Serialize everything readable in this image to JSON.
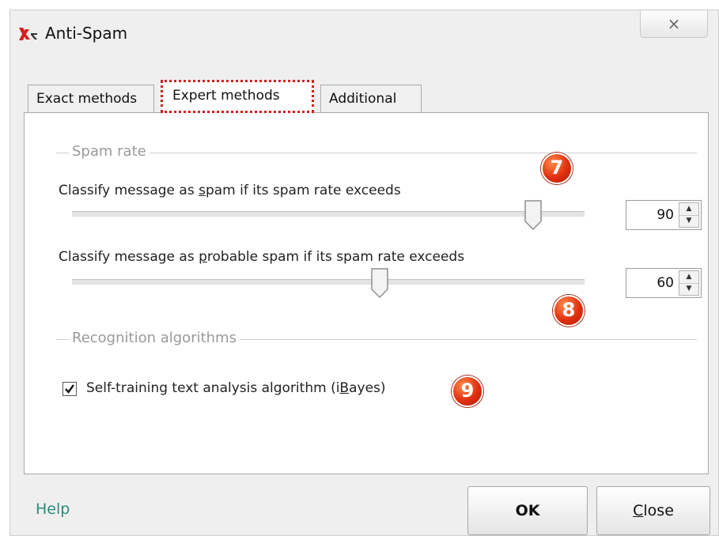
{
  "window": {
    "title": "Anti-Spam",
    "close_glyph": "×"
  },
  "tabs": [
    {
      "label": "Exact methods",
      "active": false
    },
    {
      "label": "Expert methods",
      "active": true,
      "highlight_color": "#d41e1e"
    },
    {
      "label": "Additional",
      "active": false
    }
  ],
  "spam_rate": {
    "group_title": "Spam rate",
    "spam": {
      "label_pre": "Classify message as ",
      "label_accel": "s",
      "label_post": "pam if its spam rate exceeds",
      "value": "90",
      "slider_percent": 90
    },
    "probable": {
      "label_pre": "Classify message as ",
      "label_accel": "p",
      "label_post": "robable spam if its spam rate exceeds",
      "value": "60",
      "slider_percent": 60
    }
  },
  "recognition": {
    "group_title": "Recognition algorithms",
    "ibayes": {
      "label_pre": "Self-training text analysis algorithm (i",
      "label_accel": "B",
      "label_post": "ayes)",
      "checked": true
    }
  },
  "badges": [
    "7",
    "8",
    "9"
  ],
  "footer": {
    "help": "Help",
    "ok": "OK",
    "close_accel": "C",
    "close_rest": "lose"
  },
  "colors": {
    "help_link": "#2b8a7a",
    "badge": "#e0300f",
    "logo_red": "#d42020"
  },
  "icons": {
    "logo": "kaspersky-logo-icon",
    "check": "checkmark-icon",
    "spin_up": "arrow-up-icon",
    "spin_down": "arrow-down-icon"
  }
}
